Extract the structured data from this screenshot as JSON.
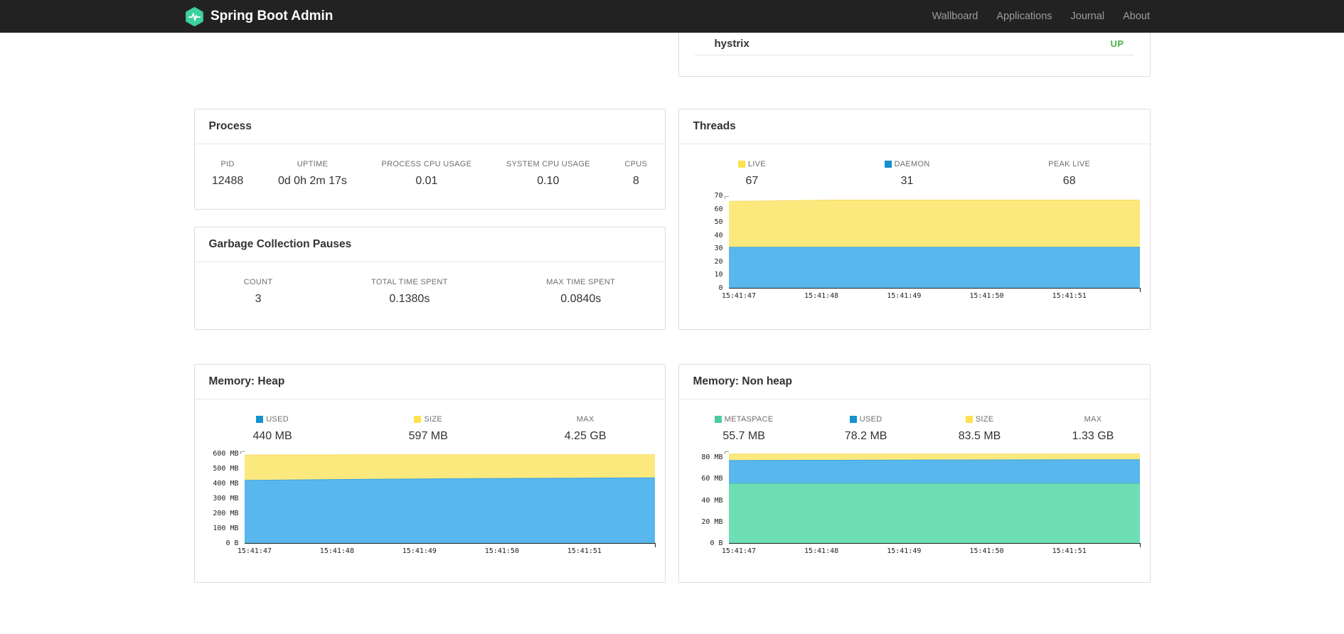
{
  "navbar": {
    "brand": "Spring Boot Admin",
    "items": [
      {
        "label": "Wallboard"
      },
      {
        "label": "Applications"
      },
      {
        "label": "Journal"
      },
      {
        "label": "About"
      }
    ]
  },
  "colors": {
    "brand_teal": "#3ed0a0",
    "status_up_green": "#45b649",
    "chart_yellow": "#FCE97E",
    "chart_blue": "#58B7EC",
    "chart_green": "#6EDFB5",
    "legend_yellow": "#FFE14D",
    "legend_blue": "#1691D0",
    "legend_green": "#4BCE9F"
  },
  "application_card": {
    "name": "hystrix",
    "status": "UP",
    "status_color": "#45b649"
  },
  "process": {
    "title": "Process",
    "stats": [
      {
        "label": "PID",
        "value": "12488"
      },
      {
        "label": "UPTIME",
        "value": "0d 0h 2m 17s"
      },
      {
        "label": "PROCESS CPU USAGE",
        "value": "0.01"
      },
      {
        "label": "SYSTEM CPU USAGE",
        "value": "0.10"
      },
      {
        "label": "CPUS",
        "value": "8"
      }
    ]
  },
  "gc": {
    "title": "Garbage Collection Pauses",
    "stats": [
      {
        "label": "COUNT",
        "value": "3"
      },
      {
        "label": "TOTAL TIME SPENT",
        "value": "0.1380s"
      },
      {
        "label": "MAX TIME SPENT",
        "value": "0.0840s"
      }
    ]
  },
  "threads": {
    "title": "Threads",
    "legend": [
      {
        "label": "LIVE",
        "value": "67",
        "swatch": "#FFE14D"
      },
      {
        "label": "DAEMON",
        "value": "31",
        "swatch": "#1691D0"
      },
      {
        "label": "PEAK LIVE",
        "value": "68"
      }
    ]
  },
  "heap": {
    "title": "Memory: Heap",
    "legend": [
      {
        "label": "USED",
        "value": "440 MB",
        "swatch": "#1691D0"
      },
      {
        "label": "SIZE",
        "value": "597 MB",
        "swatch": "#FFE14D"
      },
      {
        "label": "MAX",
        "value": "4.25 GB"
      }
    ]
  },
  "nonheap": {
    "title": "Memory: Non heap",
    "legend": [
      {
        "label": "METASPACE",
        "value": "55.7 MB",
        "swatch": "#4BCE9F"
      },
      {
        "label": "USED",
        "value": "78.2 MB",
        "swatch": "#1691D0"
      },
      {
        "label": "SIZE",
        "value": "83.5 MB",
        "swatch": "#FFE14D"
      },
      {
        "label": "MAX",
        "value": "1.33 GB"
      }
    ]
  },
  "chart_data": [
    {
      "id": "threads-chart",
      "type": "area",
      "title": "Threads",
      "stacked": true,
      "legend_position": "top",
      "grid": false,
      "x_labels": [
        "15:41:47",
        "15:41:48",
        "15:41:49",
        "15:41:50",
        "15:41:51"
      ],
      "y_max": 70,
      "ylim": [
        0,
        70
      ],
      "y_ticks": [
        {
          "label": "70",
          "value": 70
        },
        {
          "label": "60",
          "value": 60
        },
        {
          "label": "50",
          "value": 50
        },
        {
          "label": "40",
          "value": 40
        },
        {
          "label": "30",
          "value": 30
        },
        {
          "label": "20",
          "value": 20
        },
        {
          "label": "10",
          "value": 10
        },
        {
          "label": "0",
          "value": 0
        }
      ],
      "series": [
        {
          "name": "LIVE",
          "tops": [
            66,
            67,
            67,
            67,
            67
          ],
          "fill": "#FCE97E",
          "stroke": "#F6DA63"
        },
        {
          "name": "DAEMON",
          "tops": [
            31,
            31,
            31,
            31,
            31
          ],
          "fill": "#58B7EC",
          "stroke": "#3FA4DE"
        }
      ]
    },
    {
      "id": "heap-chart",
      "type": "area",
      "title": "Memory: Heap",
      "stacked": true,
      "grid": false,
      "x_labels": [
        "15:41:47",
        "15:41:48",
        "15:41:49",
        "15:41:50",
        "15:41:51"
      ],
      "y_max": 620,
      "ylim": [
        0,
        620
      ],
      "y_ticks": [
        {
          "label": "600 MB",
          "value": 600
        },
        {
          "label": "500 MB",
          "value": 500
        },
        {
          "label": "400 MB",
          "value": 400
        },
        {
          "label": "300 MB",
          "value": 300
        },
        {
          "label": "200 MB",
          "value": 200
        },
        {
          "label": "100 MB",
          "value": 100
        },
        {
          "label": "0 B",
          "value": 0
        }
      ],
      "series": [
        {
          "name": "SIZE",
          "tops": [
            595,
            597,
            597,
            597,
            597
          ],
          "fill": "#FCE97E",
          "stroke": "#F6DA63"
        },
        {
          "name": "USED",
          "tops": [
            424,
            430,
            435,
            438,
            441
          ],
          "fill": "#58B7EC",
          "stroke": "#3FA4DE"
        }
      ]
    },
    {
      "id": "nonheap-chart",
      "type": "area",
      "title": "Memory: Non heap",
      "stacked": true,
      "grid": false,
      "x_labels": [
        "15:41:47",
        "15:41:48",
        "15:41:49",
        "15:41:50",
        "15:41:51"
      ],
      "y_max": 86,
      "ylim": [
        0,
        86
      ],
      "y_ticks": [
        {
          "label": "80 MB",
          "value": 80
        },
        {
          "label": "60 MB",
          "value": 60
        },
        {
          "label": "40 MB",
          "value": 40
        },
        {
          "label": "20 MB",
          "value": 20
        },
        {
          "label": "0 B",
          "value": 0
        }
      ],
      "series": [
        {
          "name": "SIZE",
          "tops": [
            83.5,
            83.5,
            83.5,
            83.5,
            83.5
          ],
          "fill": "#FCE97E",
          "stroke": "#F6DA63"
        },
        {
          "name": "USED",
          "tops": [
            77.4,
            77.7,
            77.9,
            78.1,
            78.2
          ],
          "fill": "#58B7EC",
          "stroke": "#3FA4DE"
        },
        {
          "name": "METASPACE",
          "tops": [
            55.7,
            55.7,
            55.7,
            55.7,
            55.7
          ],
          "fill": "#6EDFB5",
          "stroke": "#52CFA3"
        }
      ]
    }
  ]
}
